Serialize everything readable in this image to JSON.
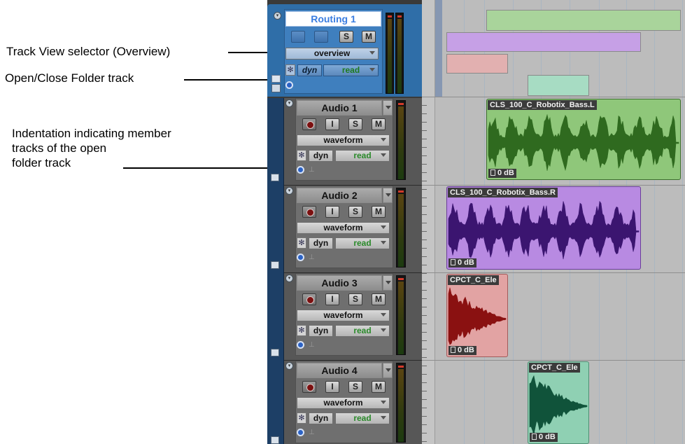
{
  "callouts": {
    "track_view_selector": "Track View selector (Overview)",
    "open_close_folder": "Open/Close Folder track",
    "indentation_line1": "Indentation indicating member",
    "indentation_line2": "tracks of the open",
    "indentation_line3": "folder track"
  },
  "folder_track": {
    "name": "Routing 1",
    "solo_label": "S",
    "mute_label": "M",
    "view_selector": "overview",
    "dyn_label": "dyn",
    "automation_mode": "read"
  },
  "tracks": [
    {
      "name": "Audio 1",
      "input_label": "I",
      "solo_label": "S",
      "mute_label": "M",
      "view_selector": "waveform",
      "dyn_label": "dyn",
      "automation_mode": "read"
    },
    {
      "name": "Audio 2",
      "input_label": "I",
      "solo_label": "S",
      "mute_label": "M",
      "view_selector": "waveform",
      "dyn_label": "dyn",
      "automation_mode": "read"
    },
    {
      "name": "Audio 3",
      "input_label": "I",
      "solo_label": "S",
      "mute_label": "M",
      "view_selector": "waveform",
      "dyn_label": "dyn",
      "automation_mode": "read"
    },
    {
      "name": "Audio 4",
      "input_label": "I",
      "solo_label": "S",
      "mute_label": "M",
      "view_selector": "waveform",
      "dyn_label": "dyn",
      "automation_mode": "read"
    }
  ],
  "clips": [
    {
      "name": "CLS_100_C_Robotix_Bass.L",
      "gain": "0 dB",
      "color": "#2f6a1f",
      "fill": "#8fc77a",
      "border": "#3d6f2e"
    },
    {
      "name": "CLS_100_C_Robotix_Bass.R",
      "gain": "0 dB",
      "color": "#3b1570",
      "fill": "#b88ae2",
      "border": "#6a3d9a"
    },
    {
      "name": "CPCT_C_Ele",
      "gain": "0 dB",
      "color": "#8a1111",
      "fill": "#e2a3a3",
      "border": "#a25b5b"
    },
    {
      "name": "CPCT_C_Ele",
      "gain": "0 dB",
      "color": "#10533a",
      "fill": "#8fd0b3",
      "border": "#4f8f74"
    }
  ],
  "overview_bars": [
    {
      "color": "#a9d49b"
    },
    {
      "color": "#c6a0e6"
    },
    {
      "color": "#e2b0b0"
    },
    {
      "color": "#a7dcc3"
    }
  ],
  "icons": {
    "collapse": "collapse-icon",
    "record": "record-icon",
    "voice": "voice-icon",
    "folder": "folder-icon",
    "folder_member": "folder-member-icon"
  }
}
